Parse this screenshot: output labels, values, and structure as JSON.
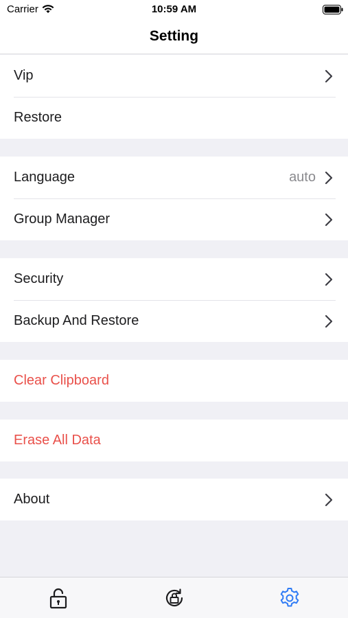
{
  "status_bar": {
    "carrier": "Carrier",
    "time": "10:59 AM"
  },
  "nav": {
    "title": "Setting"
  },
  "sections": [
    {
      "rows": [
        {
          "label": "Vip",
          "chevron": true,
          "style": "normal"
        },
        {
          "label": "Restore",
          "chevron": false,
          "style": "normal"
        }
      ]
    },
    {
      "rows": [
        {
          "label": "Language",
          "value": "auto",
          "chevron": true,
          "style": "normal"
        },
        {
          "label": "Group Manager",
          "chevron": true,
          "style": "normal"
        }
      ]
    },
    {
      "rows": [
        {
          "label": "Security",
          "chevron": true,
          "style": "normal"
        },
        {
          "label": "Backup And Restore",
          "chevron": true,
          "style": "normal"
        }
      ]
    },
    {
      "rows": [
        {
          "label": "Clear Clipboard",
          "chevron": false,
          "style": "danger"
        }
      ]
    },
    {
      "rows": [
        {
          "label": "Erase All Data",
          "chevron": false,
          "style": "danger"
        }
      ]
    },
    {
      "rows": [
        {
          "label": "About",
          "chevron": true,
          "style": "normal"
        }
      ]
    }
  ],
  "tab_bar": {
    "tabs": [
      {
        "icon": "unlock-icon",
        "selected": false
      },
      {
        "icon": "refresh-lock-icon",
        "selected": false
      },
      {
        "icon": "gear-icon",
        "selected": true
      }
    ]
  },
  "colors": {
    "accent": "#2f7bf5",
    "danger": "#e9504a",
    "background": "#f0f0f5",
    "secondary_text": "#8a8a8e"
  }
}
